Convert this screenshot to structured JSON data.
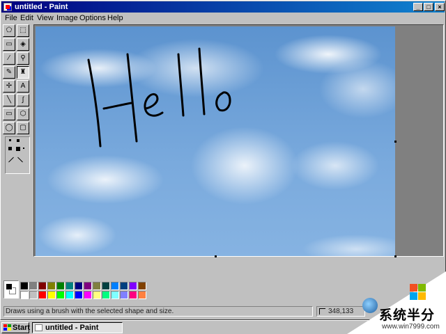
{
  "window": {
    "title": "untitled - Paint",
    "controls": [
      "minimize",
      "maximize",
      "close"
    ]
  },
  "menu": [
    "File",
    "Edit",
    "View",
    "Image",
    "Options",
    "Help"
  ],
  "tools": [
    {
      "name": "free-form-select-icon",
      "glyph": "⬠"
    },
    {
      "name": "rect-select-icon",
      "glyph": "⬚"
    },
    {
      "name": "eraser-icon",
      "glyph": "▭"
    },
    {
      "name": "fill-bucket-icon",
      "glyph": "◈"
    },
    {
      "name": "eyedropper-icon",
      "glyph": "⁄"
    },
    {
      "name": "magnifier-icon",
      "glyph": "⚲"
    },
    {
      "name": "pencil-icon",
      "glyph": "✎"
    },
    {
      "name": "brush-icon",
      "glyph": "♜"
    },
    {
      "name": "airbrush-icon",
      "glyph": "✢"
    },
    {
      "name": "text-tool-icon",
      "glyph": "A"
    },
    {
      "name": "line-tool-icon",
      "glyph": "╲"
    },
    {
      "name": "curve-tool-icon",
      "glyph": "∫"
    },
    {
      "name": "rectangle-tool-icon",
      "glyph": "▭"
    },
    {
      "name": "polygon-tool-icon",
      "glyph": "⬡"
    },
    {
      "name": "ellipse-tool-icon",
      "glyph": "◯"
    },
    {
      "name": "rounded-rect-tool-icon",
      "glyph": "▢"
    }
  ],
  "selected_tool": "brush-icon",
  "canvas": {
    "drawn_text": "Hello",
    "stroke_color": "#000000"
  },
  "palette": {
    "foreground": "#000000",
    "background": "#ffffff",
    "top_row": [
      "#000000",
      "#808080",
      "#800000",
      "#808000",
      "#008000",
      "#008080",
      "#000080",
      "#800080",
      "#808040",
      "#004040",
      "#0080ff",
      "#004080",
      "#8000ff",
      "#804000"
    ],
    "bottom_row": [
      "#ffffff",
      "#c0c0c0",
      "#ff0000",
      "#ffff00",
      "#00ff00",
      "#00ffff",
      "#0000ff",
      "#ff00ff",
      "#ffff80",
      "#00ff80",
      "#80ffff",
      "#8080ff",
      "#ff0080",
      "#ff8040"
    ]
  },
  "status": {
    "message": "Draws using a brush with the selected shape and size.",
    "coords": "348,133"
  },
  "taskbar": {
    "start_label": "Start",
    "task_label": "untitled - Paint"
  },
  "watermark": {
    "text": "系统半分",
    "url": "www.win7999.com"
  }
}
